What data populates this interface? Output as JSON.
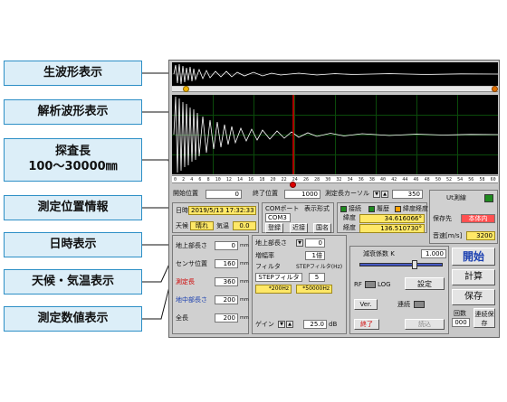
{
  "callouts": {
    "raw_waveform": "生波形表示",
    "analysis_waveform": "解析波形表示",
    "exploration_length_title": "探査長",
    "exploration_length_range": "100～30000㎜",
    "position_info": "測定位置情報",
    "datetime_display": "日時表示",
    "weather_temp": "天候・気温表示",
    "measured_values": "測定数値表示"
  },
  "ruler": {
    "ticks": [
      "0",
      "2",
      "4",
      "6",
      "8",
      "10",
      "12",
      "14",
      "16",
      "18",
      "20",
      "22",
      "24",
      "26",
      "28",
      "30",
      "32",
      "34",
      "36",
      "38",
      "40",
      "42",
      "44",
      "46",
      "48",
      "50",
      "52",
      "54",
      "56",
      "58",
      "60"
    ]
  },
  "position_row": {
    "start_label": "開始位置",
    "start_value": "0",
    "end_label": "終了位置",
    "end_value": "1000",
    "cursor_label": "測定長カーソル",
    "cursor_value": "350"
  },
  "status_panel": {
    "datetime_label": "日時",
    "datetime_value": "2019/5/13 17:32:33",
    "weather_label": "天候",
    "weather_value": "晴れ",
    "temp_label": "気温",
    "temp_value": "0.0"
  },
  "measurements": [
    {
      "label": "地上部長さ",
      "value": "0",
      "unit": "mm"
    },
    {
      "label": "センサ位置",
      "value": "160",
      "unit": "mm"
    },
    {
      "label": "測定長",
      "value": "360",
      "unit": "mm"
    },
    {
      "label": "地中部長さ",
      "value": "200",
      "unit": "mm"
    },
    {
      "label": "全長",
      "value": "200",
      "unit": "mm"
    }
  ],
  "com_panel": {
    "com_label": "COMポート",
    "com_value": "COM3",
    "display_label": "表示形式",
    "btn_register": "登録",
    "btn_approach": "近接",
    "btn_country": "国名"
  },
  "position_panel": {
    "lamp1_label": "接続",
    "lamp2_label": "履歴",
    "lamp3_label": "緯度経度",
    "lat_label": "緯度",
    "lat_value": "34.616066°",
    "lon_label": "経度",
    "lon_value": "136.510730°"
  },
  "right_panel": {
    "ur_label": "Ut測線",
    "save_label": "保存先",
    "save_value": "本体内",
    "speed_label": "音速[m/s]",
    "speed_value": "3200"
  },
  "param_panel": {
    "ground_label": "地上部長さ",
    "ground_value": "0",
    "gain_label": "増幅率",
    "gain_value": "1倍",
    "filter_label": "フィルタ",
    "step_label": "STEPフィルタ(Hz)",
    "filter_value": "STEPフィルタ",
    "step_value": "5",
    "freq_low": "*200Hz",
    "freq_high": "*50000Hz",
    "gain2_label": "ゲイン",
    "gain2_value": "25.0",
    "gain2_unit": "dB"
  },
  "control_panel": {
    "attenuation_label": "減衰係数 K",
    "attenuation_value": "1.000",
    "rf_label": "RF",
    "log_label": "LOG",
    "ver_label": "Ver.",
    "continuous_label": "連続",
    "end_label": "終了",
    "setting_label": "設定",
    "reading_label": "読込"
  },
  "actions": {
    "start": "開始",
    "calc": "計算",
    "save": "保存",
    "count_label": "回数",
    "count_value": "000",
    "continuous_save": "連続保存"
  },
  "colors": {
    "callout_fill": "#dceef8",
    "callout_border": "#2d8fc6",
    "ruler_marker_left": "#f0b400",
    "ruler_marker_right": "#e07000",
    "cursor_line": "#e00000",
    "start_button_text": "#1a3fb0",
    "measure_label_red": "#d00000",
    "measure_label_blue": "#1a3fb0",
    "lamp_green": "#1f8a1f"
  }
}
